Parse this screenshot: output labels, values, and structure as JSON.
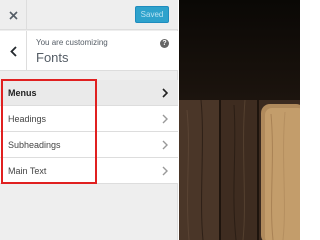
{
  "toolbar": {
    "close_icon": "close-icon",
    "saved_label": "Saved"
  },
  "header": {
    "back_icon": "chevron-left-icon",
    "customizing_label": "You are customizing",
    "section_title": "Fonts",
    "help_icon_glyph": "?"
  },
  "menu": {
    "items": [
      {
        "label": "Menus",
        "active": true
      },
      {
        "label": "Headings",
        "active": false
      },
      {
        "label": "Subheadings",
        "active": false
      },
      {
        "label": "Main Text",
        "active": false
      }
    ]
  },
  "colors": {
    "saved_button_bg": "#2ea2cc",
    "highlight_border": "#e02020",
    "panel_bg": "#eeeeee"
  }
}
